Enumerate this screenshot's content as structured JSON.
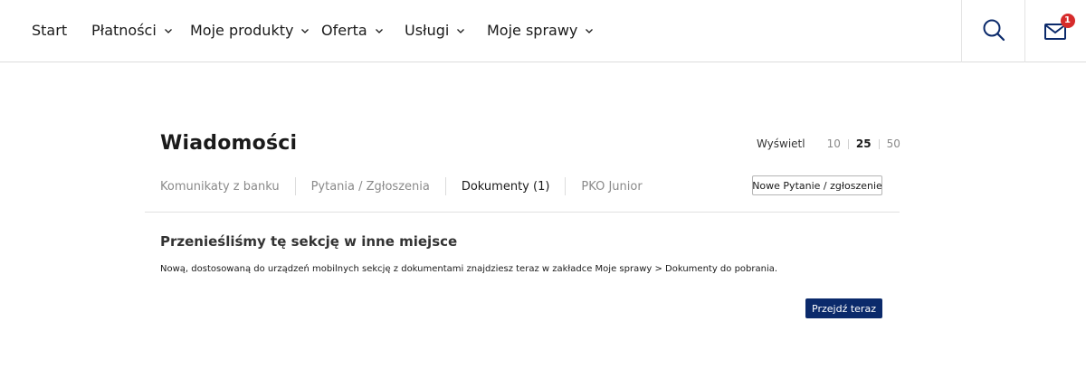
{
  "nav": {
    "items": [
      {
        "label": "Start",
        "dropdown": false
      },
      {
        "label": "Płatności",
        "dropdown": true
      },
      {
        "label": "Moje produkty",
        "dropdown": true
      },
      {
        "label": "Oferta",
        "dropdown": true
      },
      {
        "label": "Usługi",
        "dropdown": true
      },
      {
        "label": "Moje sprawy",
        "dropdown": true
      }
    ],
    "search_icon": "search-icon",
    "mail_icon": "mail-icon",
    "mail_badge_count": "1"
  },
  "page": {
    "title": "Wiadomości",
    "view": {
      "label": "Wyświetl",
      "options": [
        "10",
        "25",
        "50"
      ],
      "selected": "25"
    },
    "tabs": [
      {
        "label": "Komunikaty z banku",
        "active": false
      },
      {
        "label": "Pytania / Zgłoszenia",
        "active": false
      },
      {
        "label": "Dokumenty (1)",
        "active": true
      },
      {
        "label": "PKO Junior",
        "active": false
      }
    ],
    "new_question_button": "Nowe Pytanie / zgłoszenie",
    "section_title": "Przenieśliśmy tę sekcję w inne miejsce",
    "section_text": "Nową, dostosowaną do urządzeń mobilnych sekcję z dokumentami znajdziesz teraz w zakładce Moje sprawy > Dokumenty do pobrania.",
    "go_button": "Przejdź teraz"
  },
  "colors": {
    "primary_button": "#0b2a6b",
    "badge": "#d62b2b",
    "icon": "#0b2a6b"
  }
}
